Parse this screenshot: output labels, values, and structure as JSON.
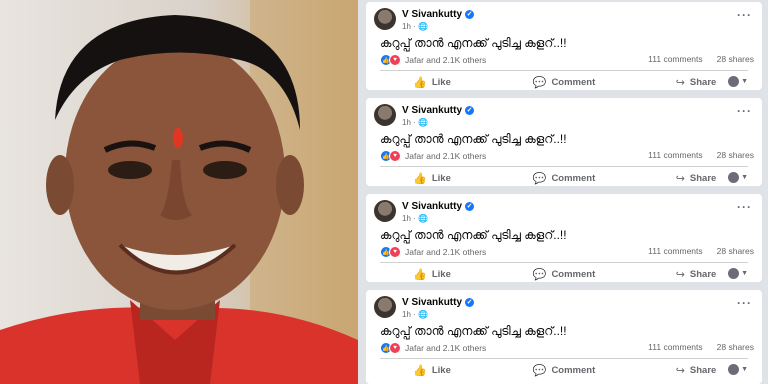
{
  "photo": {
    "alt": ""
  },
  "posts": [
    {
      "author": "V Sivankutty",
      "time": "1h",
      "text": "കറുപ്പ് താൻ എനക്ക് പുടിച്ച കളറ്..!!",
      "reactors": "Jafar and 2.1K others",
      "comments": "111 comments",
      "shares": "28 shares",
      "like": "Like",
      "comment": "Comment",
      "share": "Share"
    },
    {
      "author": "V Sivankutty",
      "time": "1h",
      "text": "കറുപ്പ് താൻ എനക്ക് പുടിച്ച കളറ്..!!",
      "reactors": "Jafar and 2.1K others",
      "comments": "111 comments",
      "shares": "28 shares",
      "like": "Like",
      "comment": "Comment",
      "share": "Share"
    },
    {
      "author": "V Sivankutty",
      "time": "1h",
      "text": "കറുപ്പ് താൻ എനക്ക് പുടിച്ച കളറ്..!!",
      "reactors": "Jafar and 2.1K others",
      "comments": "111 comments",
      "shares": "28 shares",
      "like": "Like",
      "comment": "Comment",
      "share": "Share"
    },
    {
      "author": "V Sivankutty",
      "time": "1h",
      "text": "കറുപ്പ് താൻ എനക്ക് പുടിച്ച കളറ്..!!",
      "reactors": "Jafar and 2.1K others",
      "comments": "111 comments",
      "shares": "28 shares",
      "like": "Like",
      "comment": "Comment",
      "share": "Share"
    }
  ],
  "colors": {
    "accent": "#1877f2",
    "love": "#f33e58",
    "muted": "#65676b"
  }
}
